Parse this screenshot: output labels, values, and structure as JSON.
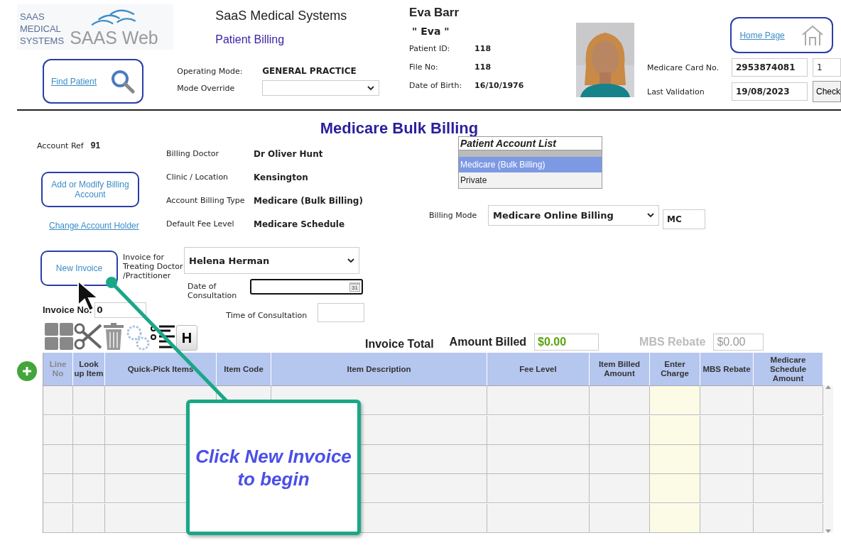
{
  "logo": {
    "lines": [
      "SAAS",
      "MEDICAL",
      "SYSTEMS"
    ],
    "product": "SAAS Web"
  },
  "header": {
    "app_title": "SaaS Medical Systems",
    "subtitle": "Patient Billing",
    "find_patient": "Find Patient",
    "operating_mode_label": "Operating Mode:",
    "operating_mode": "GENERAL PRACTICE",
    "mode_override_label": "Mode Override"
  },
  "patient": {
    "name": "Eva Barr",
    "nickname": "\" Eva \"",
    "fields": [
      {
        "label": "Patient ID:",
        "value": "118"
      },
      {
        "label": "File No:",
        "value": "118"
      },
      {
        "label": "Date of Birth:",
        "value": "16/10/1976"
      }
    ]
  },
  "home_page": "Home Page",
  "medicare": {
    "card_label": "Medicare Card No.",
    "card_number": "2953874081",
    "irn": "1",
    "validation_label": "Last Validation",
    "validation_date": "19/08/2023",
    "check_button": "Check"
  },
  "page_title": "Medicare Bulk Billing",
  "account": {
    "ref_label": "Account Ref",
    "ref": "91",
    "modify_button": "Add or Modify Billing Account",
    "change_holder_link": "Change Account Holder",
    "details": [
      {
        "label": "Billing Doctor",
        "value": "Dr Oliver Hunt"
      },
      {
        "label": "Clinic / Location",
        "value": "Kensington"
      },
      {
        "label": "Account Billing Type",
        "value": "Medicare (Bulk Billing)"
      },
      {
        "label": "Default Fee Level",
        "value": "Medicare Schedule"
      }
    ]
  },
  "account_list": {
    "title": "Patient Account List",
    "items": [
      {
        "label": "Medicare (Bulk Billing)",
        "selected": true
      },
      {
        "label": "Private",
        "selected": false
      }
    ]
  },
  "billing_mode": {
    "label": "Billing Mode",
    "value": "Medicare Online Billing",
    "code": "MC"
  },
  "invoice": {
    "new_button": "New Invoice",
    "treating_label": "Invoice for Treating Doctor /Practitioner",
    "practitioner": "Helena Herman",
    "date_label": "Date of Consultation",
    "calendar_day": "31",
    "number_label": "Invoice No.",
    "number": "0",
    "time_label": "Time of Consultation",
    "help_button": "H"
  },
  "totals": [
    {
      "label": "Invoice Total",
      "disabled": false
    },
    {
      "label": "Amount Billed",
      "value": "$0.00",
      "disabled": false
    },
    {
      "label": "MBS Rebate",
      "value": "$0.00",
      "disabled": true
    }
  ],
  "table": {
    "columns": [
      {
        "label": "Line No",
        "muted": true,
        "highlight": false
      },
      {
        "label": "Look up Item",
        "muted": false,
        "highlight": false
      },
      {
        "label": "Quick-Pick Items",
        "muted": false,
        "highlight": false
      },
      {
        "label": "Item Code",
        "muted": false,
        "highlight": false
      },
      {
        "label": "Item Description",
        "muted": false,
        "highlight": false
      },
      {
        "label": "Fee Level",
        "muted": false,
        "highlight": false
      },
      {
        "label": "Item Billed Amount",
        "muted": false,
        "highlight": false
      },
      {
        "label": "Enter Charge",
        "muted": false,
        "highlight": true
      },
      {
        "label": "MBS Rebate",
        "muted": false,
        "highlight": false
      },
      {
        "label": "Medicare Schedule Amount",
        "muted": false,
        "highlight": false
      }
    ]
  },
  "callout": {
    "text": "Click New Invoice to begin"
  }
}
